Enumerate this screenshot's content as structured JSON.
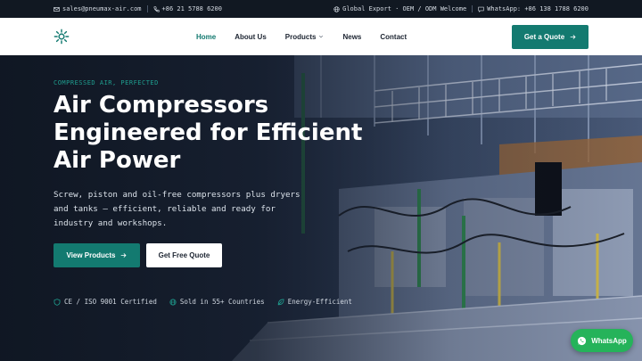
{
  "topbar": {
    "email": "sales@pneumax-air.com",
    "phone": "+86 21 5788 6200",
    "export": "Global Export · OEM / ODM Welcome",
    "whatsapp": "WhatsApp: +86 138 1788 6200"
  },
  "nav": {
    "items": [
      {
        "label": "Home",
        "active": true
      },
      {
        "label": "About Us"
      },
      {
        "label": "Products",
        "dropdown": true
      },
      {
        "label": "News"
      },
      {
        "label": "Contact"
      }
    ],
    "cta": "Get a Quote"
  },
  "hero": {
    "eyebrow": "COMPRESSED AIR, PERFECTED",
    "headline": [
      "Air Compressors",
      "Engineered for Efficient",
      "Air Power"
    ],
    "subtitle": "Screw, piston and oil-free compressors plus dryers and tanks — efficient, reliable and ready for industry and workshops.",
    "primary_button": "View Products",
    "secondary_button": "Get Free Quote",
    "badges": [
      "CE / ISO 9001 Certified",
      "Sold in 55+ Countries",
      "Energy-Efficient"
    ]
  },
  "whatsapp_button": "WhatsApp",
  "colors": {
    "accent": "#137a70",
    "topbar": "#111822",
    "whatsapp": "#25b35a"
  }
}
